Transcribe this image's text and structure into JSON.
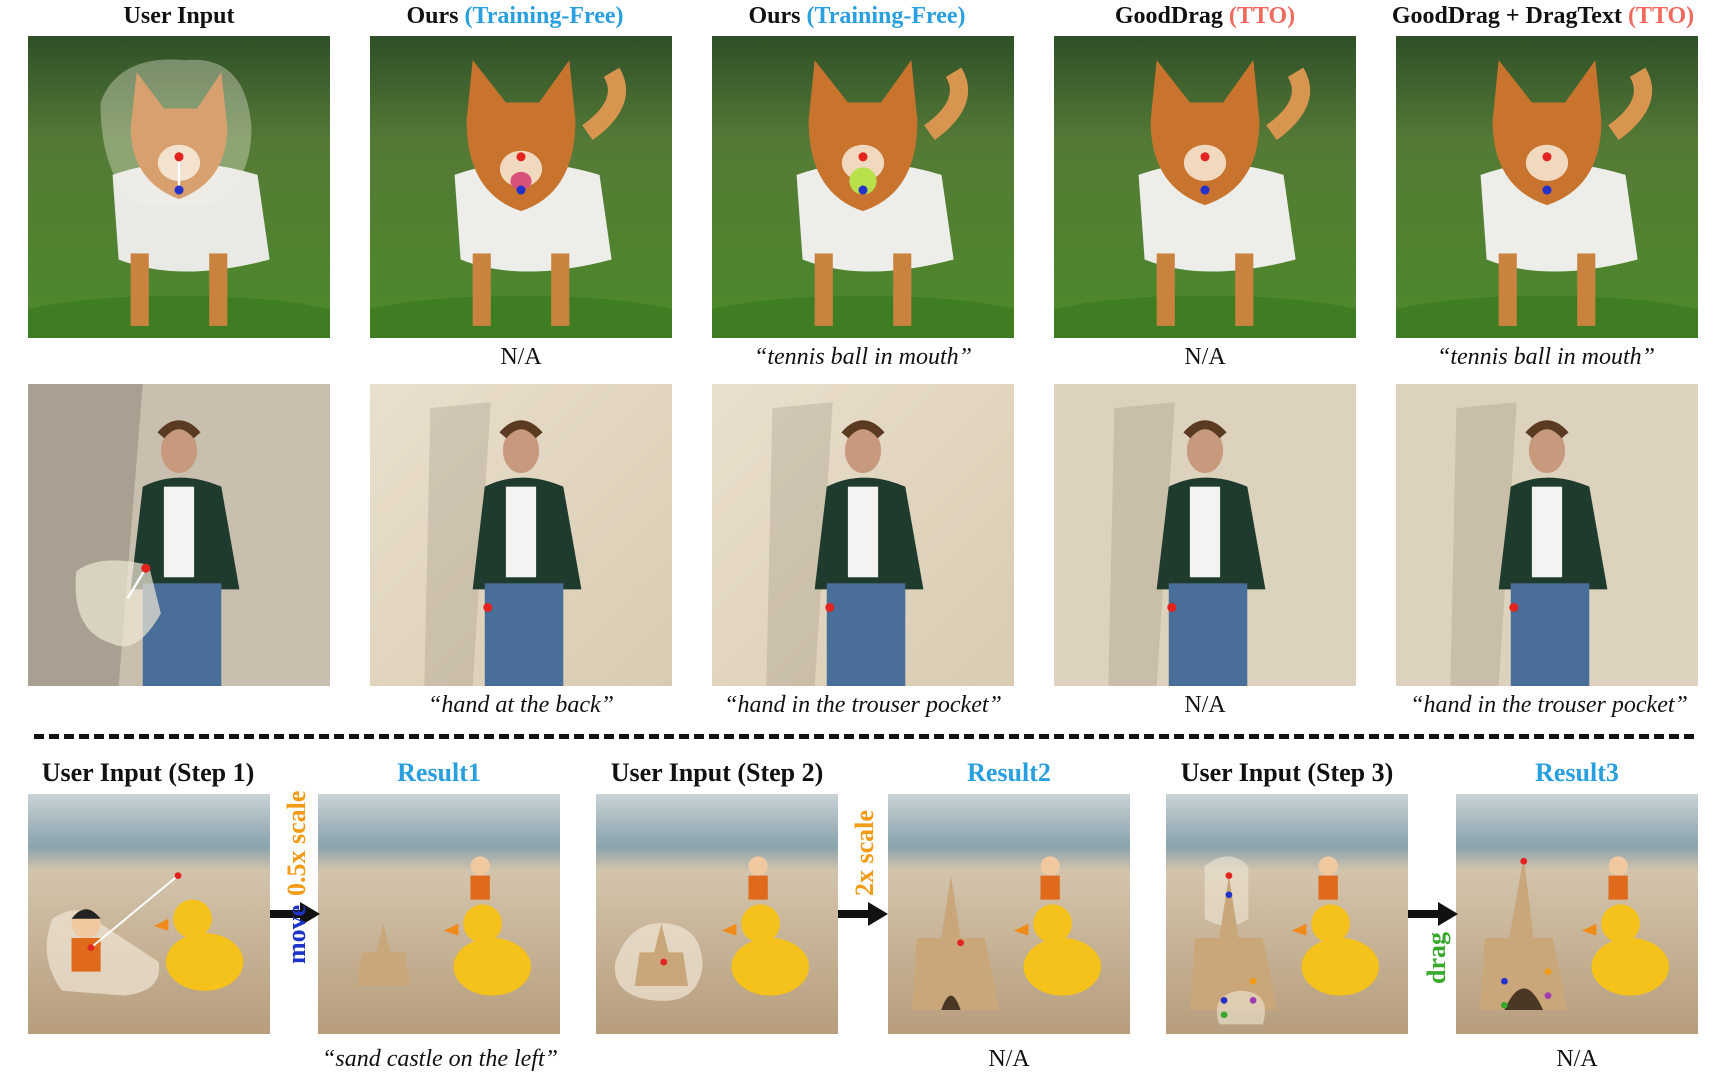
{
  "headers": {
    "user_input": "User Input",
    "ours": "Ours",
    "training_free": "(Training-Free)",
    "gooddrag": "GoodDrag",
    "gooddrag_dragtext": "GoodDrag + DragText",
    "tto": "(TTO)"
  },
  "row1_captions": [
    "N/A",
    "“tennis ball in mouth”",
    "N/A",
    "“tennis ball in mouth”"
  ],
  "row2_captions": [
    "“hand at the back”",
    "“hand in the trouser pocket”",
    "N/A",
    "“hand in the trouser pocket”"
  ],
  "bottom": {
    "headers": [
      "User Input (Step 1)",
      "Result1",
      "User Input (Step 2)",
      "Result2",
      "User Input (Step 3)",
      "Result3"
    ],
    "ops": [
      {
        "main": "move",
        "sub": "0.5x scale"
      },
      {
        "main": "2x scale",
        "sub": ""
      },
      {
        "main": "drag",
        "sub": ""
      }
    ],
    "captions": [
      "“sand castle on the left”",
      "N/A",
      "N/A"
    ]
  },
  "colors": {
    "accent_blue": "#2a9fdf",
    "accent_red": "#f06b5e",
    "op_blue": "#1e33c8",
    "op_orange": "#f29b17",
    "op_green": "#39a82d"
  }
}
